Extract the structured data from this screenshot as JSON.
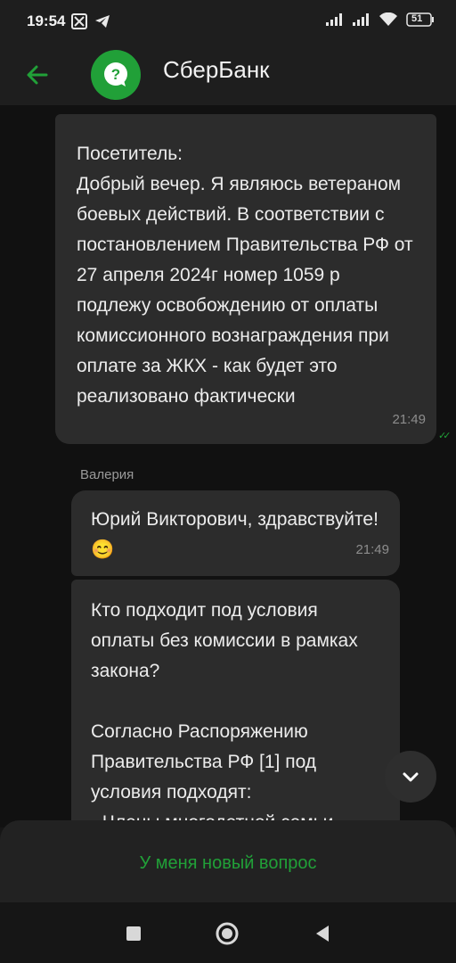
{
  "status_bar": {
    "time": "19:54",
    "battery": "51"
  },
  "header": {
    "title": "СберБанк"
  },
  "messages": [
    {
      "text": "Посетитель:\nДобрый вечер. Я являюсь ветераном боевых действий. В соответствии с  постановлением Правительства РФ от 27 апреля 2024г  номер 1059 р подлежу освобождению от оплаты комиссионного вознаграждения при оплате за ЖКХ -   как будет это реализовано фактически",
      "time": "21:49"
    },
    {
      "sender": "Валерия",
      "text": "Юрий Викторович, здравствуйте! 😊",
      "time": "21:49"
    },
    {
      "text": "Кто подходит под условия оплаты без комиссии в рамках закона?\n\nСогласно Распоряжению Правительства РФ [1] под условия подходят:\n- Члены многодетной семьи"
    }
  ],
  "actions": {
    "new_question": "У меня новый вопрос"
  },
  "colors": {
    "accent": "#21a038",
    "bubble": "#2c2c2c",
    "background": "#111111"
  }
}
